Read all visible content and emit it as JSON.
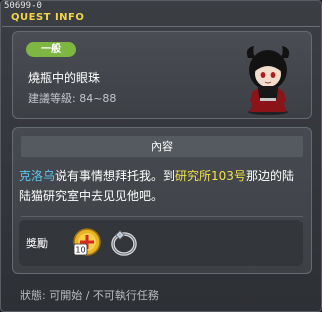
{
  "window": {
    "quest_id": "50699-0",
    "title": "QUEST INFO"
  },
  "quest": {
    "category": "一般",
    "name": "燒瓶中的眼珠",
    "level_label": "建議等級",
    "level_separator": ":",
    "level_range": "84~88"
  },
  "content": {
    "header": "內容",
    "description_parts": {
      "p1": "克洛乌",
      "p2": "说有事情想拜托我。到",
      "p3": "研究所103号",
      "p4": "那边的陆陆猫研究室中去见见他吧。"
    },
    "highlight_colors": {
      "npc": "#5ec8f2",
      "location": "#f2e24a"
    }
  },
  "rewards": {
    "label": "獎勵",
    "items": [
      {
        "icon": "exp-coin-icon",
        "quantity": "10"
      },
      {
        "icon": "silver-ring-icon"
      }
    ]
  },
  "status": {
    "label": "狀態",
    "separator": ":",
    "text": "可開始 / 不可執行任務"
  },
  "colors": {
    "accent_title": "#f2d54a",
    "badge": "#7db642"
  }
}
